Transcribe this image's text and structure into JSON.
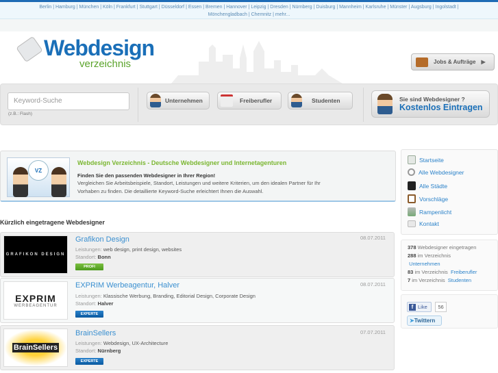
{
  "city_links": [
    "Berlin",
    "Hamburg",
    "München",
    "Köln",
    "Frankfurt",
    "Stuttgart",
    "Düsseldorf",
    "Essen",
    "Bremen",
    "Hannover",
    "Leipzig",
    "Dresden",
    "Nürnberg",
    "Duisburg",
    "Mannheim",
    "Karlsruhe",
    "Münster",
    "Augsburg",
    "Ingolstadt",
    "Mönchengladbach",
    "Chemnitz",
    "mehr..."
  ],
  "logo": {
    "main": "Webdesign",
    "sub": "verzeichnis"
  },
  "jobs_button": "Jobs & Aufträge",
  "search": {
    "placeholder": "Keyword-Suche",
    "hint": "(z.B.: Flash)"
  },
  "categories": [
    "Unternehmen",
    "Freiberufler",
    "Studenten"
  ],
  "register": {
    "line1": "Sie sind Webdesigner ?",
    "line2": "Kostenlos Eintragen"
  },
  "intro": {
    "title": "Webdesign Verzeichnis - Deutsche Webdesigner und Internetagenturen",
    "bold": "Finden Sie den passenden Webdesigner in Ihrer Region!",
    "text": "Vergleichen Sie Arbeitsbeispiele, Standort, Leistungen und weitere Kriterien, um den idealen Partner für Ihr Vorhaben zu finden. Die detaillierte Keyword-Suche erleichtert Ihnen die Auswahl.",
    "logo_text": "VZ"
  },
  "recent_title": "Kürzlich eingetragene Webdesigner",
  "labels": {
    "services": "Leistungen:",
    "location": "Standort:"
  },
  "entries": [
    {
      "name": "Grafikon Design",
      "date": "08.07.2011",
      "services": "web design, print design, websites",
      "location": "Bonn",
      "badge": "PROFI",
      "logo_text": "GRAFIKON DESIGN"
    },
    {
      "name": "EXPRIM Werbeagentur, Halver",
      "date": "08.07.2011",
      "services": "Klassische Werbung, Branding, Editorial Design, Corporate Design",
      "location": "Halver",
      "badge": "EXPERTE",
      "logo_text": "EXPRIM",
      "logo_sub": "WERBEAGENTUR"
    },
    {
      "name": "BrainSellers",
      "date": "07.07.2011",
      "services": "Webdesign, UX-Architecture",
      "location": "Nürnberg",
      "badge": "EXPERTE",
      "logo_text": "BrainSellers"
    }
  ],
  "nav": [
    "Startseite",
    "Alle Webdesigner",
    "Alle Städte",
    "Vorschläge",
    "Rampenlicht",
    "Kontakt"
  ],
  "stats": {
    "total": "378",
    "total_label": "Webdesigner eingetragen",
    "companies": "288",
    "students": "7",
    "freelancers": "83",
    "in_dir": "im Verzeichnis",
    "companies_link": "Unternehmen",
    "freelancers_link": "Freiberufler",
    "students_link": "Studenten"
  },
  "social": {
    "like": "Like",
    "like_count": "56",
    "tweet": "Twittern"
  }
}
